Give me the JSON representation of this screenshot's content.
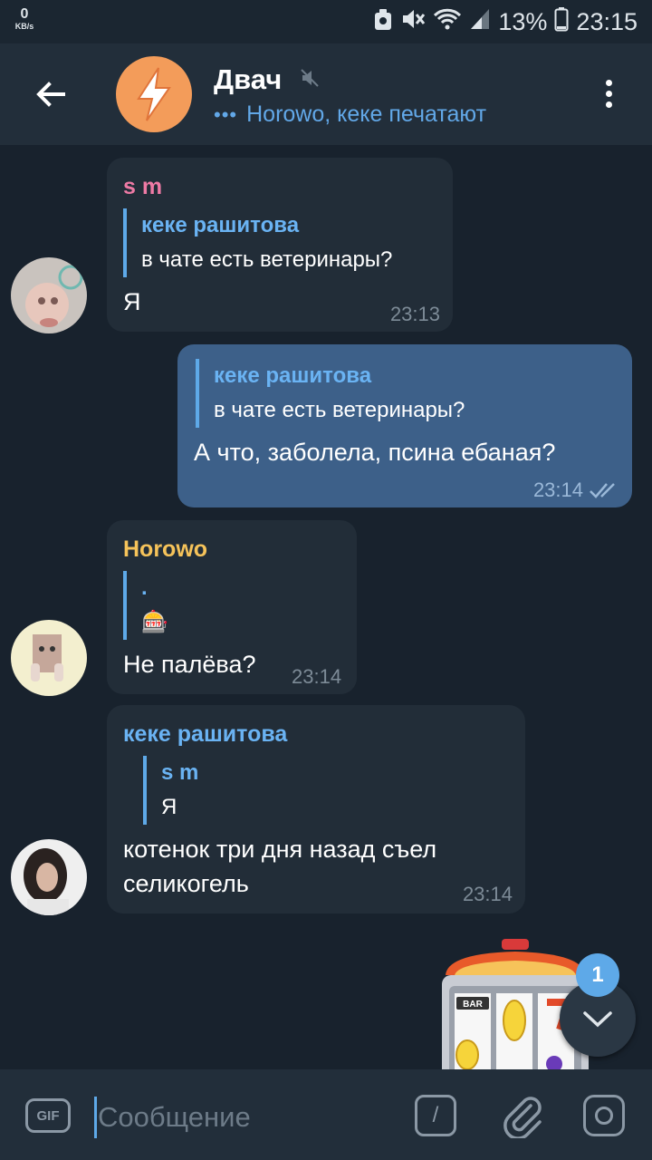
{
  "status_bar": {
    "net_speed": "0",
    "net_unit": "KB/s",
    "battery": "13%",
    "time": "23:15"
  },
  "header": {
    "title": "Двач",
    "typing": "Horowo, кеке печатают"
  },
  "messages": [
    {
      "sender": "s m",
      "sender_color": "#ee7aa5",
      "reply_name": "кеке рашитова",
      "reply_text": "в чате есть ветеринары?",
      "text": "Я",
      "time": "23:13"
    },
    {
      "reply_name": "кеке рашитова",
      "reply_text": "в чате есть ветеринары?",
      "text": "А что, заболела, псина ебаная?",
      "time": "23:14"
    },
    {
      "sender": "Horowo",
      "sender_color": "#f6c35a",
      "reply_name": ".",
      "reply_text": "🎰",
      "text": "Не палёва?",
      "time": "23:14"
    },
    {
      "sender": "кеке рашитова",
      "sender_color": "#6ab3f3",
      "reply_name": "s m",
      "reply_text": "Я",
      "text_line1": "котенок три дня назад съел",
      "text_line2": "селикогель",
      "time": "23:14"
    }
  ],
  "unread_count": "1",
  "slot_label": "BAR",
  "input": {
    "placeholder": "Сообщение",
    "gif_label": "GIF",
    "command_label": "/"
  },
  "colors": {
    "accent": "#5ea9e8",
    "outgoing_bubble": "#3d6089",
    "incoming_bubble": "#222d38"
  }
}
